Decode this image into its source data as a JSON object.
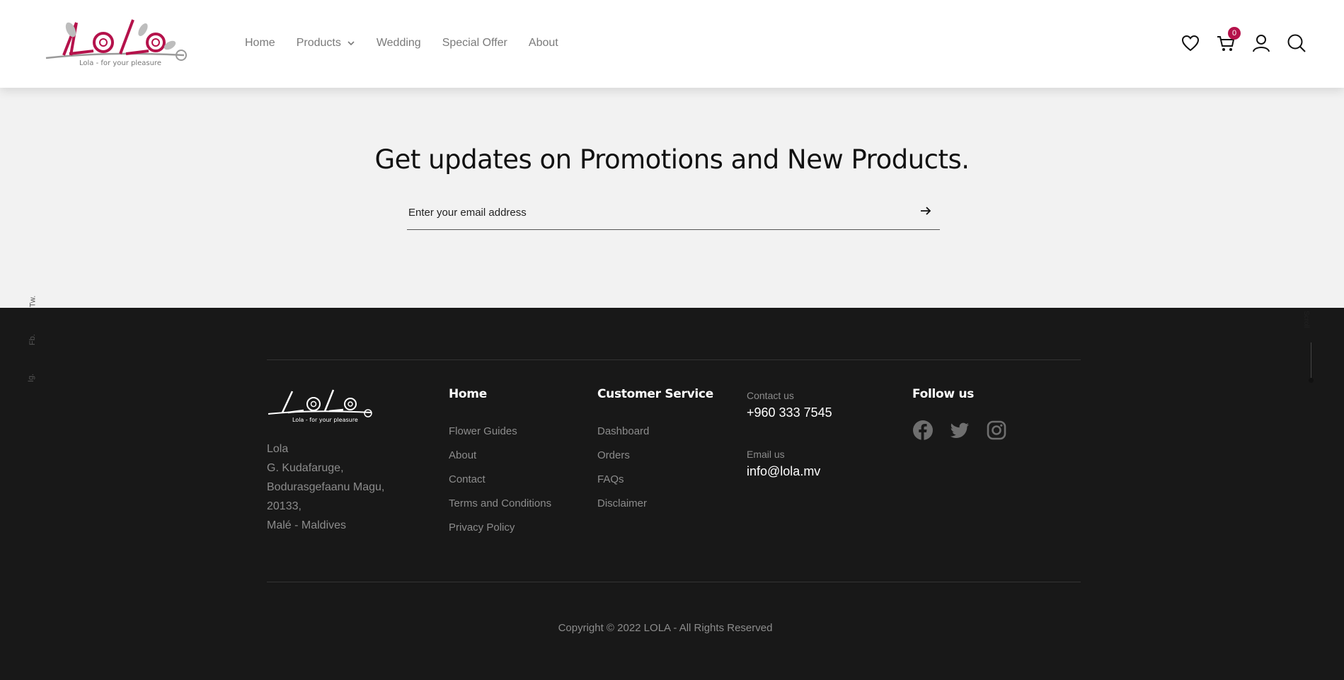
{
  "header": {
    "logo_tagline": "Lola - for your pleasure",
    "nav": {
      "home": "Home",
      "products": "Products",
      "wedding": "Wedding",
      "special_offer": "Special Offer",
      "about": "About"
    },
    "cart_count": "0",
    "icons": [
      "heart-icon",
      "cart-icon",
      "user-icon",
      "search-icon"
    ],
    "accent": "#b5124b"
  },
  "newsletter": {
    "title": "Get updates on Promotions and New Products.",
    "placeholder": "Enter your email address"
  },
  "side_share": {
    "left_labels": [
      "Tw.",
      "Fb.",
      "Ig."
    ],
    "right_label": "Scroll"
  },
  "footer": {
    "logo_tagline": "Lola - for your pleasure",
    "address": {
      "line1": "Lola",
      "line2": "G. Kudafaruge,",
      "line3": "Bodurasgefaanu Magu,",
      "line4": "20133,",
      "line5": "Malé - Maldives"
    },
    "home_col": {
      "title": "Home",
      "links": [
        "Flower Guides",
        "About",
        "Contact",
        "Terms and Conditions",
        "Privacy Policy"
      ]
    },
    "cs_col": {
      "title": "Customer Service",
      "links": [
        "Dashboard",
        "Orders",
        "FAQs",
        "Disclaimer"
      ]
    },
    "contact": {
      "contact_label": "Contact us",
      "phone": "+960 333 7545",
      "email_label": "Email us",
      "email": "info@lola.mv"
    },
    "follow": {
      "title": "Follow us",
      "icons": [
        "facebook-icon",
        "twitter-icon",
        "instagram-icon"
      ]
    },
    "copyright": "Copyright © 2022 LOLA - All Rights Reserved"
  }
}
